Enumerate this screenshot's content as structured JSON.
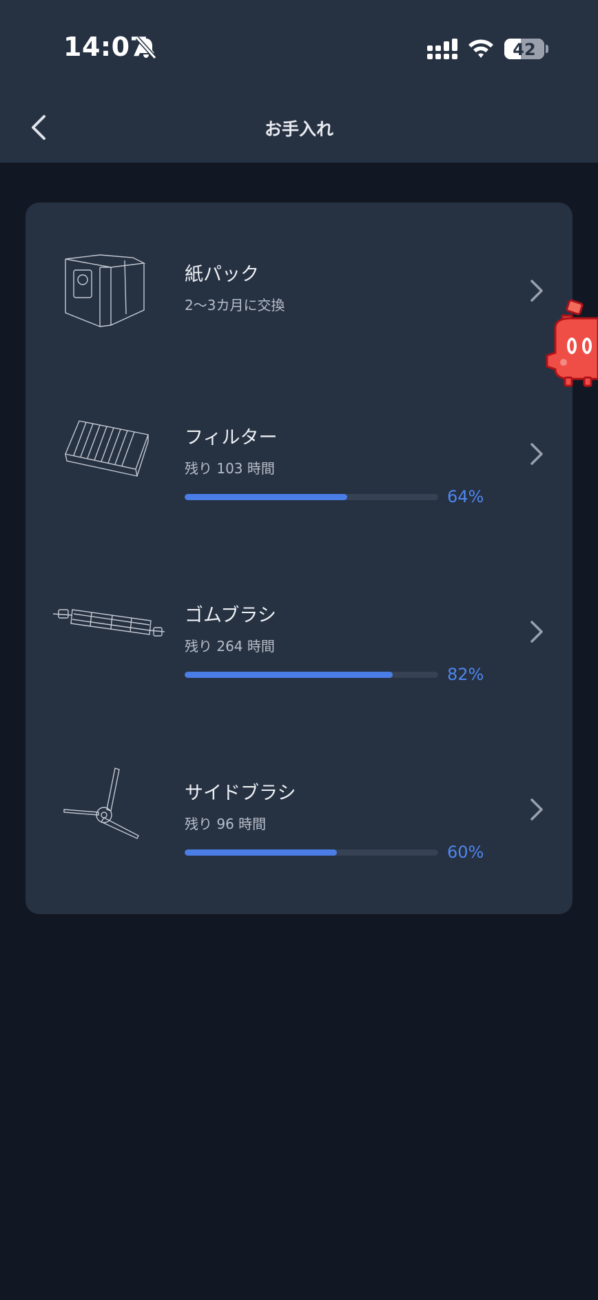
{
  "status_bar": {
    "time": "14:07",
    "battery_level": "42",
    "battery_fraction": 0.42,
    "icons": [
      "bell-slash-icon",
      "cellular-signal-icon",
      "wifi-icon",
      "battery-icon"
    ]
  },
  "nav": {
    "title": "お手入れ",
    "back_icon": "chevron-left-icon"
  },
  "items": [
    {
      "name": "紙パック",
      "subtitle": "2～3カ月に交換",
      "icon": "dust-bag-icon"
    },
    {
      "name": "フィルター",
      "subtitle": "残り 103 時間",
      "percent_label": "64%",
      "progress": 0.64,
      "icon": "filter-icon"
    },
    {
      "name": "ゴムブラシ",
      "subtitle": "残り 264 時間",
      "percent_label": "82%",
      "progress": 0.82,
      "icon": "rubber-brush-icon"
    },
    {
      "name": "サイドブラシ",
      "subtitle": "残り 96 時間",
      "percent_label": "60%",
      "progress": 0.6,
      "icon": "side-brush-icon"
    }
  ],
  "colors": {
    "background": "#121823",
    "card": "#263142",
    "accent": "#4a7ee6",
    "track": "#364253"
  }
}
